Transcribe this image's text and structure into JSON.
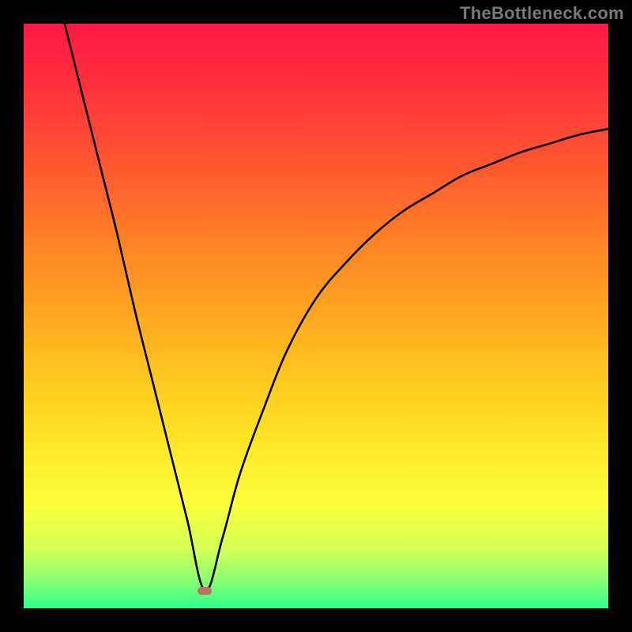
{
  "watermark": "TheBottleneck.com",
  "colors": {
    "frame": "#000000",
    "watermark": "#77797a",
    "curve": "#000000",
    "min_marker": "#c46f64",
    "gradient_stops": [
      {
        "offset": 0.0,
        "color": "#ff1745"
      },
      {
        "offset": 0.1,
        "color": "#ff2f3d"
      },
      {
        "offset": 0.25,
        "color": "#ff5a2f"
      },
      {
        "offset": 0.4,
        "color": "#ff8a24"
      },
      {
        "offset": 0.55,
        "color": "#ffb71e"
      },
      {
        "offset": 0.7,
        "color": "#ffe224"
      },
      {
        "offset": 0.82,
        "color": "#fbff3a"
      },
      {
        "offset": 0.9,
        "color": "#d4ff57"
      },
      {
        "offset": 0.95,
        "color": "#8cff70"
      },
      {
        "offset": 1.0,
        "color": "#2fff8a"
      }
    ]
  },
  "chart_data": {
    "type": "line",
    "title": "",
    "xlabel": "",
    "ylabel": "",
    "xlim": [
      0,
      100
    ],
    "ylim": [
      0,
      100
    ],
    "note": "V-shaped bottleneck curve. Minimum (best match) near x≈31, y≈3. Left branch rises steeply and nearly linearly to (7,100). Right branch rises with decreasing slope to about (100,82). Background gradient maps bottleneck % (y) to color: green≈low, yellow/orange≈mid, red≈high.",
    "min_point": {
      "x": 31,
      "y": 3
    },
    "series": [
      {
        "name": "bottleneck-curve",
        "x": [
          7,
          10,
          13,
          16,
          19,
          22,
          25,
          28,
          31,
          34,
          37,
          41,
          45,
          50,
          55,
          60,
          65,
          70,
          75,
          80,
          85,
          90,
          95,
          100
        ],
        "y": [
          100,
          88,
          76,
          64,
          51,
          39,
          27,
          15,
          3,
          12,
          23,
          34,
          44,
          53,
          59,
          64,
          68,
          71,
          74,
          76,
          78,
          79.5,
          81,
          82
        ]
      }
    ]
  }
}
